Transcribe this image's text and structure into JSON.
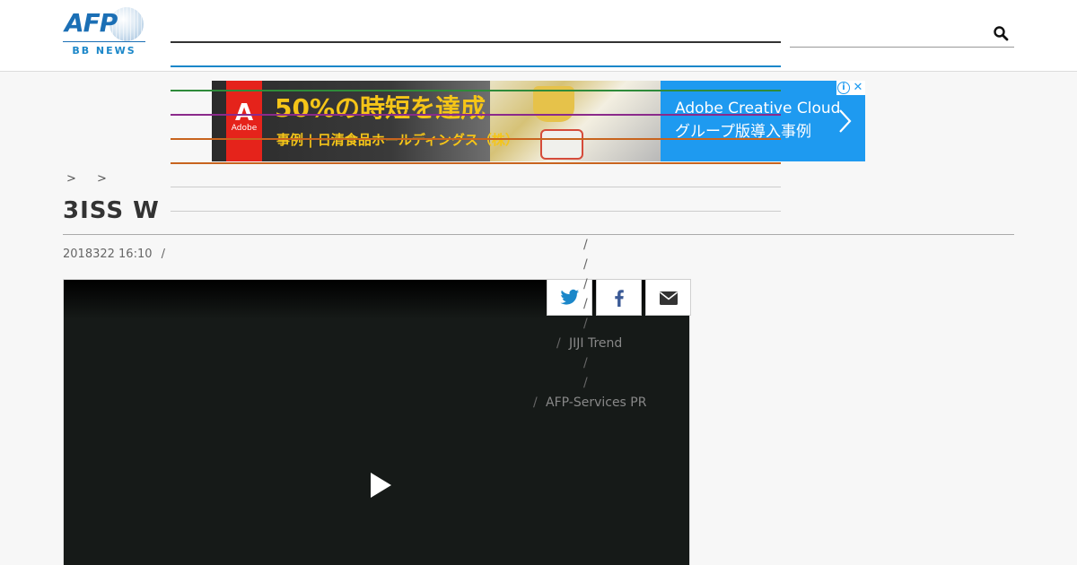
{
  "header": {
    "logo": {
      "brand": "AFP",
      "sub": "BB NEWS"
    },
    "search": {
      "placeholder": "",
      "value": ""
    },
    "nav_lines": [
      "#333333",
      "#1b87c9",
      "#2e8b3a",
      "#8b2a8b",
      "#c8641e",
      "#c8641e",
      "#cccccc",
      "#cccccc"
    ]
  },
  "ad": {
    "headline": "50%の時短を達成",
    "sub": "事例 | 日清食品ホールディングス（株）",
    "adobe_label": "Adobe",
    "right_line1": "Adobe Creative Cloud",
    "right_line2": "グループ版導入事例",
    "accent": "#1e9af0",
    "headline_color": "#f5c518"
  },
  "breadcrumb": {
    "sep1": ">",
    "sep2": ">"
  },
  "article": {
    "title": "3ISS W",
    "meta_date": "2018322 16:10",
    "meta_sep": "/"
  },
  "share": {
    "twitter": "twitter-icon",
    "facebook": "facebook-icon",
    "email": "envelope-icon"
  },
  "menu": {
    "slash": "/",
    "jiji": "JIJI Trend",
    "afp_services": "AFP-Services PR"
  }
}
